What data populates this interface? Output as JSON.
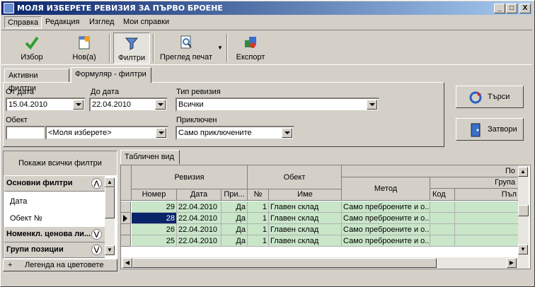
{
  "window": {
    "title": "МОЛЯ ИЗБЕРЕТЕ РЕВИЗИЯ ЗА ПЪРВО БРОЕНЕ",
    "min": "_",
    "max": "□",
    "close": "X"
  },
  "menu": {
    "items": [
      "Справка",
      "Редакция",
      "Изглед",
      "Мои справки"
    ]
  },
  "toolbar": {
    "select": "Избор",
    "new": "Нов(а)",
    "filters": "Филтри",
    "print_preview": "Преглед печат",
    "export": "Експорт"
  },
  "filter_tabs": [
    "Активни филтри",
    "Формуляр - филтри"
  ],
  "form": {
    "from_date_label": "От дата",
    "from_date": "15.04.2010",
    "to_date_label": "До дата",
    "to_date": "22.04.2010",
    "type_label": "Тип ревизия",
    "type_value": "Всички",
    "object_label": "Обект",
    "object_code": "",
    "object_value": "<Моля изберете>",
    "finished_label": "Приключен",
    "finished_value": "Само приключените"
  },
  "buttons": {
    "search": "Търси",
    "close": "Затвори"
  },
  "left_panel": {
    "show_all": "Покажи всички филтри",
    "group_basic": "Основни филтри",
    "items": [
      "Дата",
      "Обект №"
    ],
    "group_price": "Номенкл. ценова ли...",
    "group_positions": "Групи позиции",
    "legend": "Легенда на цветовете",
    "legend_sign": "+"
  },
  "grid": {
    "tab": "Табличен вид",
    "header_top": {
      "revision": "Ревизия",
      "object": "Обект",
      "group_p": "По",
      "group_sub": "Група"
    },
    "columns": {
      "number": "Номер",
      "date": "Дата",
      "pri": "При...",
      "obj_no": "№",
      "name": "Име",
      "method": "Метод",
      "code": "Код",
      "full": "Пъл"
    },
    "rows": [
      {
        "number": "29",
        "date": "22.04.2010",
        "pri": "Да",
        "obj_no": "1",
        "name": "Главен склад",
        "method": "Само преброените и о..."
      },
      {
        "number": "28",
        "date": "22.04.2010",
        "pri": "Да",
        "obj_no": "1",
        "name": "Главен склад",
        "method": "Само преброените и о..."
      },
      {
        "number": "26",
        "date": "22.04.2010",
        "pri": "Да",
        "obj_no": "1",
        "name": "Главен склад",
        "method": "Само преброените и о..."
      },
      {
        "number": "25",
        "date": "22.04.2010",
        "pri": "Да",
        "obj_no": "1",
        "name": "Главен склад",
        "method": "Само преброените и о..."
      }
    ],
    "selected_row": 1
  },
  "colors": {
    "title_start": "#0a246a",
    "title_end": "#a6caf0",
    "row_green": "#c9e6c9",
    "selection": "#0a246a"
  }
}
